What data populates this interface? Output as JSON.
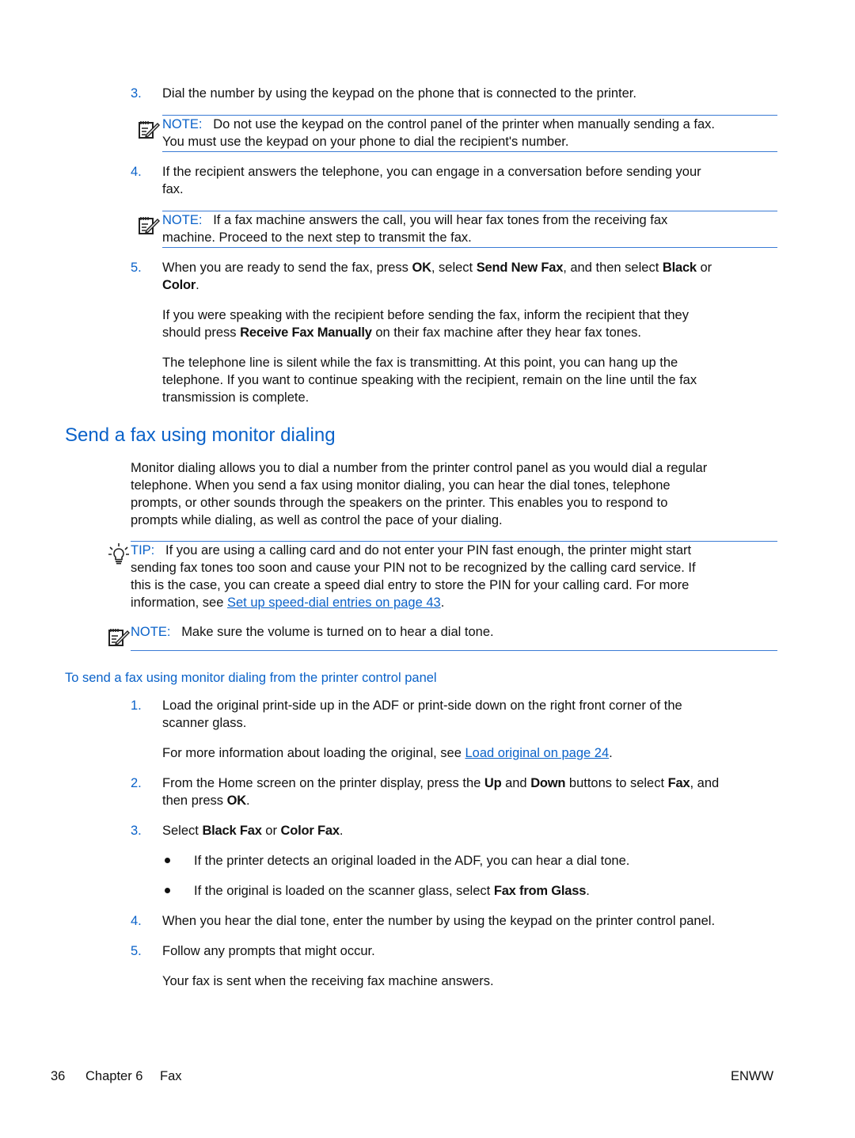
{
  "steps_top": [
    {
      "num": "3.",
      "lines": [
        "Dial the number by using the keypad on the phone that is connected to the printer."
      ]
    },
    {
      "num": "4.",
      "lines": [
        "If the recipient answers the telephone, you can engage in a conversation before sending your",
        "fax."
      ]
    },
    {
      "num": "5."
    }
  ],
  "note1": {
    "label": "NOTE:",
    "line1": "Do not use the keypad on the control panel of the printer when manually sending a fax.",
    "line2": "You must use the keypad on your phone to dial the recipient's number."
  },
  "note2": {
    "label": "NOTE:",
    "line1": "If a fax machine answers the call, you will hear fax tones from the receiving fax",
    "line2": "machine. Proceed to the next step to transmit the fax."
  },
  "step5": {
    "t1": "When you are ready to send the fax, press ",
    "b1": "OK",
    "t2": ", select ",
    "b2": "Send New Fax",
    "t3": ", and then select ",
    "b3": "Black",
    "t4": " or",
    "b4": "Color",
    "t5": "."
  },
  "para_speaking": {
    "line1": "If you were speaking with the recipient before sending the fax, inform the recipient that they",
    "t1": "should press ",
    "b1": "Receive Fax Manually",
    "t2": " on their fax machine after they hear fax tones."
  },
  "para_silent": {
    "lines": [
      "The telephone line is silent while the fax is transmitting. At this point, you can hang up the",
      "telephone. If you want to continue speaking with the recipient, remain on the line until the fax",
      "transmission is complete."
    ]
  },
  "section_heading": "Send a fax using monitor dialing",
  "intro": {
    "lines": [
      "Monitor dialing allows you to dial a number from the printer control panel as you would dial a regular",
      "telephone. When you send a fax using monitor dialing, you can hear the dial tones, telephone",
      "prompts, or other sounds through the speakers on the printer. This enables you to respond to",
      "prompts while dialing, as well as control the pace of your dialing."
    ]
  },
  "tip": {
    "label": "TIP:",
    "line1": "If you are using a calling card and do not enter your PIN fast enough, the printer might start",
    "line2": "sending fax tones too soon and cause your PIN not to be recognized by the calling card service. If",
    "line3": "this is the case, you can create a speed dial entry to store the PIN for your calling card. For more",
    "line4_pre": "information, see ",
    "link": "Set up speed-dial entries on page 43",
    "line4_post": "."
  },
  "note3": {
    "label": "NOTE:",
    "text": "Make sure the volume is turned on to hear a dial tone."
  },
  "procedure_heading": "To send a fax using monitor dialing from the printer control panel",
  "proc": {
    "s1": {
      "num": "1.",
      "line1": "Load the original print-side up in the ADF or print-side down on the right front corner of the",
      "line2": "scanner glass."
    },
    "s1_more": {
      "pre": "For more information about loading the original, see ",
      "link": "Load original on page 24",
      "post": "."
    },
    "s2": {
      "num": "2.",
      "t1": "From the Home screen on the printer display, press the ",
      "b1": "Up",
      "t2": " and ",
      "b2": "Down",
      "t3": " buttons to select ",
      "b3": "Fax",
      "t4": ", and",
      "t5": "then press ",
      "b4": "OK",
      "t6": "."
    },
    "s3": {
      "num": "3.",
      "t1": "Select ",
      "b1": "Black Fax",
      "t2": " or ",
      "b2": "Color Fax",
      "t3": "."
    },
    "bullets": [
      {
        "text": "If the printer detects an original loaded in the ADF, you can hear a dial tone."
      },
      {
        "pre": "If the original is loaded on the scanner glass, select ",
        "bold": "Fax from Glass",
        "post": "."
      }
    ],
    "s4": {
      "num": "4.",
      "text": "When you hear the dial tone, enter the number by using the keypad on the printer control panel."
    },
    "s5": {
      "num": "5.",
      "text": "Follow any prompts that might occur."
    },
    "s5_more": "Your fax is sent when the receiving fax machine answers."
  },
  "footer": {
    "page": "36",
    "chapter": "Chapter 6",
    "section": "Fax",
    "right": "ENWW"
  },
  "colors": {
    "accent": "#0a62c9",
    "rule": "#3a7bd5",
    "text": "#111111"
  },
  "icons": {
    "note": "note-pencil-icon",
    "tip": "lightbulb-icon"
  }
}
